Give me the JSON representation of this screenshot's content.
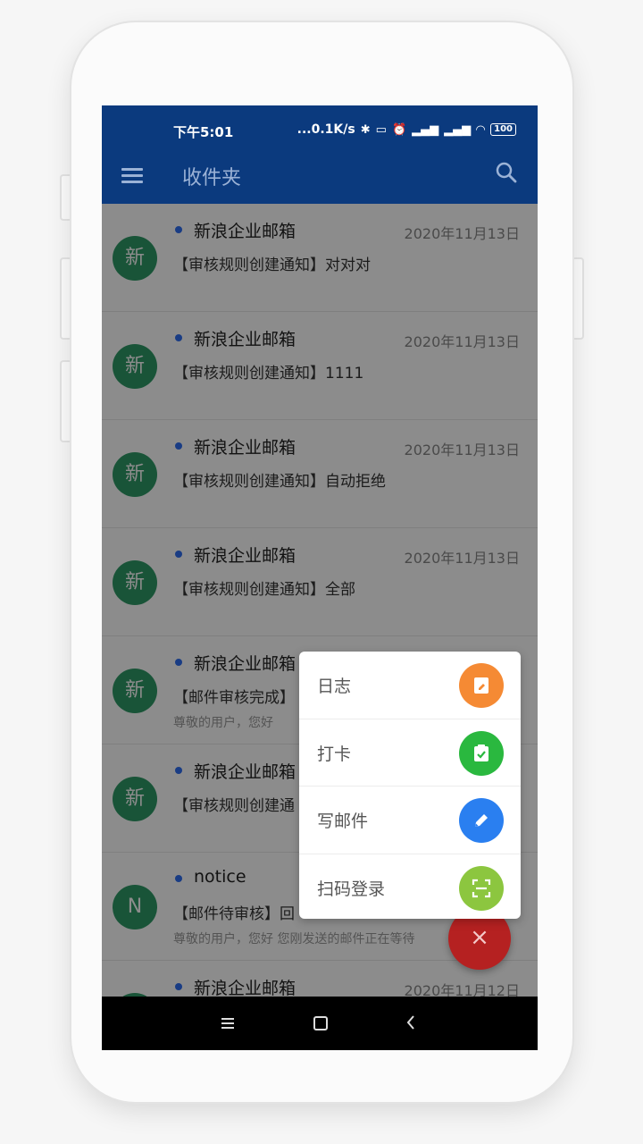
{
  "status_bar": {
    "time": "下午5:01",
    "network_speed": "...0.1K/s",
    "battery": "100"
  },
  "app_bar": {
    "title": "收件夹",
    "menu_icon": "menu-icon",
    "search_icon": "search-icon"
  },
  "mail_list": [
    {
      "avatar": "新",
      "sender": "新浪企业邮箱",
      "date": "2020年11月13日",
      "subject": "【审核规则创建通知】对对对",
      "preview": ""
    },
    {
      "avatar": "新",
      "sender": "新浪企业邮箱",
      "date": "2020年11月13日",
      "subject": "【审核规则创建通知】1111",
      "preview": ""
    },
    {
      "avatar": "新",
      "sender": "新浪企业邮箱",
      "date": "2020年11月13日",
      "subject": "【审核规则创建通知】自动拒绝",
      "preview": ""
    },
    {
      "avatar": "新",
      "sender": "新浪企业邮箱",
      "date": "2020年11月13日",
      "subject": "【审核规则创建通知】全部",
      "preview": ""
    },
    {
      "avatar": "新",
      "sender": "新浪企业邮箱",
      "date": "",
      "subject": "【邮件审核完成】",
      "preview": "尊敬的用户，您好"
    },
    {
      "avatar": "新",
      "sender": "新浪企业邮箱",
      "date": "",
      "subject": "【审核规则创建通",
      "preview": ""
    },
    {
      "avatar": "N",
      "sender": "notice",
      "date": "",
      "subject": "【邮件待审核】回",
      "preview": "尊敬的用户，您好 您刚发送的邮件正在等待"
    },
    {
      "avatar": "新",
      "sender": "新浪企业邮箱",
      "date": "2020年11月12日",
      "subject": "",
      "preview": ""
    }
  ],
  "popup_menu": [
    {
      "label": "日志",
      "icon": "note-edit-icon",
      "color": "#f58a34"
    },
    {
      "label": "打卡",
      "icon": "check-clipboard-icon",
      "color": "#2ab83f"
    },
    {
      "label": "写邮件",
      "icon": "pencil-icon",
      "color": "#2a7ff0"
    },
    {
      "label": "扫码登录",
      "icon": "scan-icon",
      "color": "#8cc63f"
    }
  ],
  "fab": {
    "symbol": "×",
    "color": "#b52121"
  },
  "colors": {
    "primary": "#0b3a7e",
    "avatar": "#2e9a66",
    "unread_dot": "#2f6ef0"
  }
}
